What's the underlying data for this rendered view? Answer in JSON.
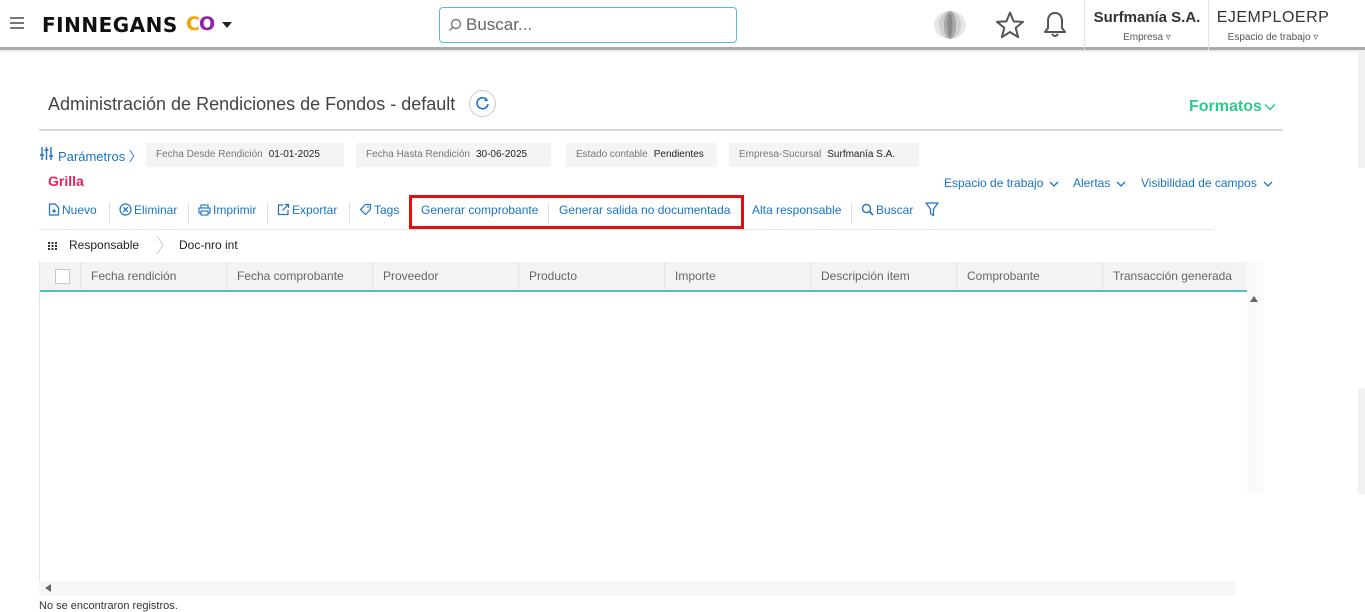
{
  "header": {
    "logo_text": "FINNEGANS",
    "logo_co_c": "C",
    "logo_co_o": "O",
    "search_placeholder": "Buscar...",
    "company": {
      "name": "Surfmanía S.A.",
      "label": "Empresa"
    },
    "workspace": {
      "name": "EJEMPLOERP",
      "label": "Espacio de trabajo"
    }
  },
  "page": {
    "title": "Administración de Rendiciones de Fondos - default",
    "formatos_label": "Formatos"
  },
  "params": {
    "label": "Parámetros",
    "fields": [
      {
        "label": "Fecha Desde Rendición",
        "value": "01-01-2025"
      },
      {
        "label": "Fecha Hasta Rendición",
        "value": "30-06-2025"
      },
      {
        "label": "Estado contable",
        "value": "Pendientes"
      },
      {
        "label": "Empresa-Sucursal",
        "value": "Surfmanía S.A."
      }
    ]
  },
  "grilla_label": "Grilla",
  "right_links": {
    "workspace": "Espacio de trabajo",
    "alerts": "Alertas",
    "visibility": "Visibilidad de campos"
  },
  "toolbar": {
    "nuevo": "Nuevo",
    "eliminar": "Eliminar",
    "imprimir": "Imprimir",
    "exportar": "Exportar",
    "tags": "Tags",
    "generar_comprobante": "Generar comprobante",
    "generar_salida": "Generar salida no documentada",
    "alta_responsable": "Alta responsable",
    "buscar": "Buscar"
  },
  "grouping": [
    "Responsable",
    "Doc-nro int"
  ],
  "table": {
    "columns": [
      "Fecha rendición",
      "Fecha comprobante",
      "Proveedor",
      "Producto",
      "Importe",
      "Descripción item",
      "Comprobante",
      "Transacción generada"
    ]
  },
  "status_text": "No se encontraron registros.",
  "colors": {
    "link": "#1a73c9",
    "accent_green": "#2ecc8b",
    "grilla": "#e0245e",
    "highlight": "#e01010",
    "header_line": "#4fc2c0"
  }
}
